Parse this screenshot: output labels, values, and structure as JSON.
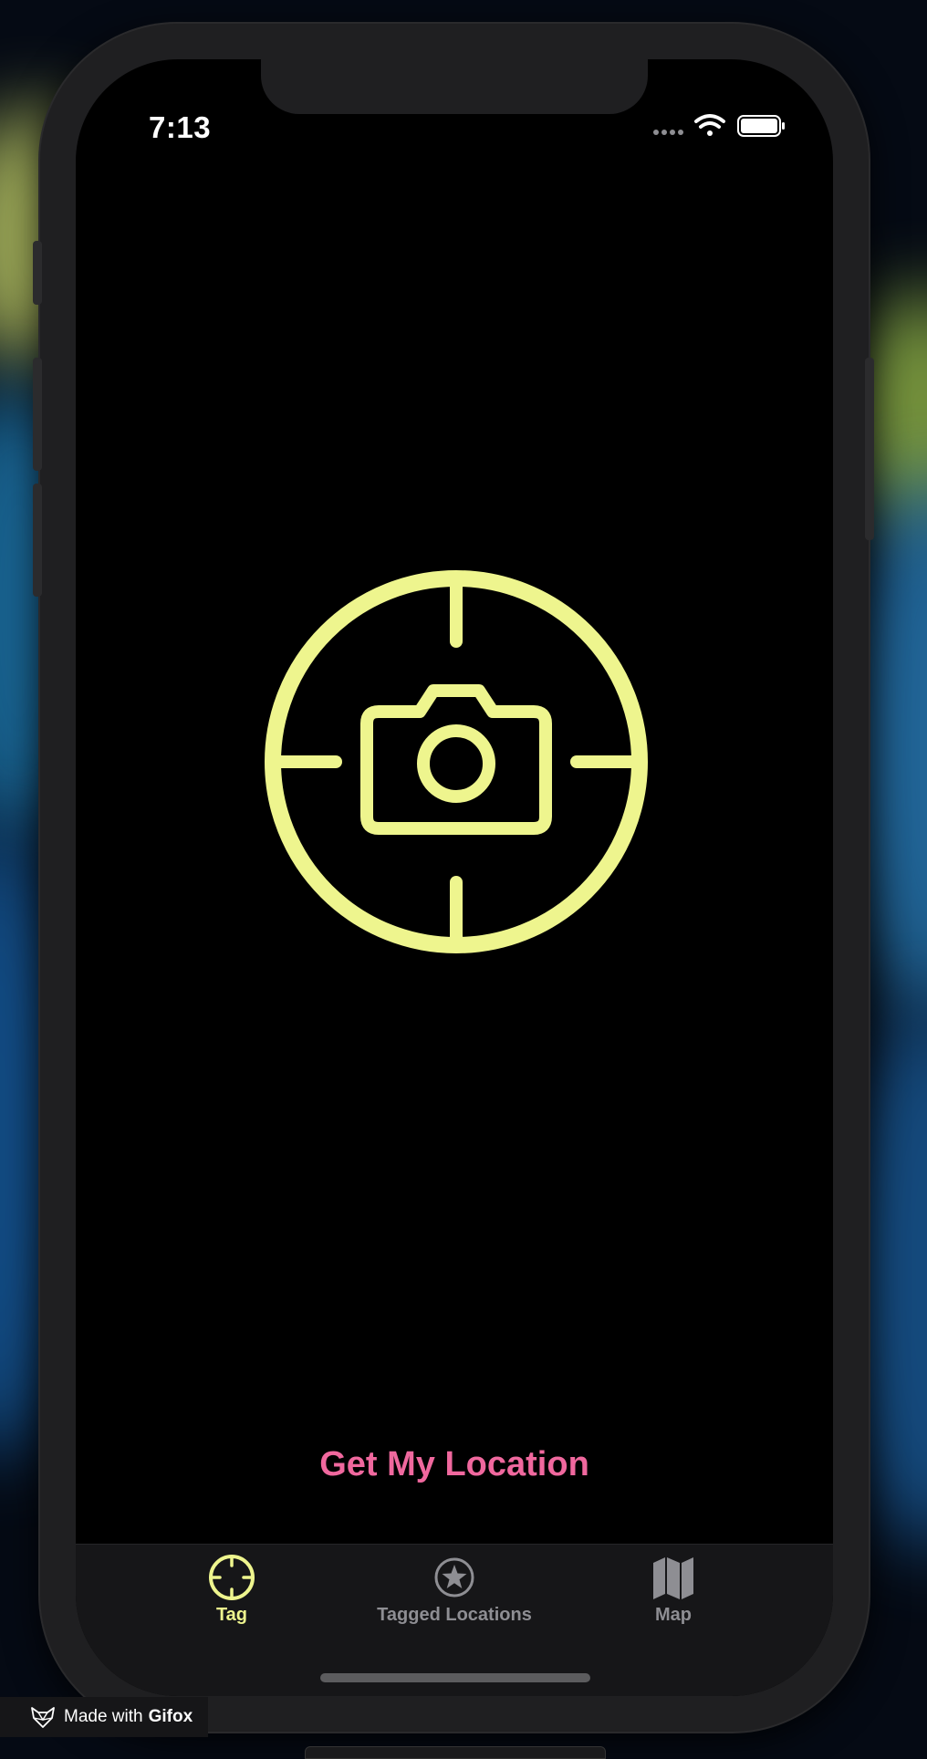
{
  "status_bar": {
    "time": "7:13",
    "icons": [
      "signal-dots-icon",
      "wifi-icon",
      "battery-icon"
    ]
  },
  "main": {
    "hero_icon": "camera-crosshair-icon",
    "action_label": "Get My Location"
  },
  "tab_bar": {
    "tabs": [
      {
        "label": "Tag",
        "icon": "crosshair-icon",
        "selected": true
      },
      {
        "label": "Tagged Locations",
        "icon": "star-circle-icon",
        "selected": false
      },
      {
        "label": "Map",
        "icon": "map-icon",
        "selected": false
      }
    ]
  },
  "watermark": {
    "prefix": "Made with",
    "brand": "Gifox"
  },
  "colors": {
    "accent_yellow": "#eef58e",
    "action_pink": "#f0689e",
    "inactive_gray": "#8e8e93",
    "screen_bg": "#000000"
  }
}
